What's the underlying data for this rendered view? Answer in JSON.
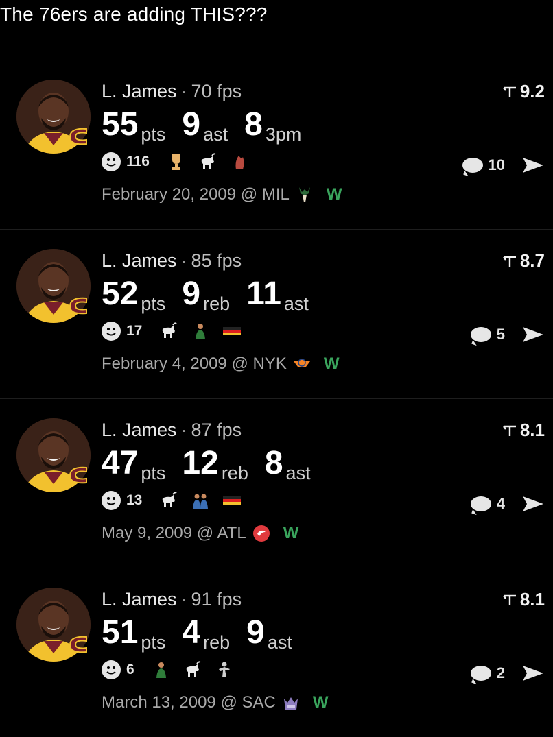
{
  "caption": "The 76ers are adding THIS???",
  "posts": [
    {
      "name": "L. James",
      "fps": "70 fps",
      "stats": [
        {
          "num": "55",
          "unit": "pts"
        },
        {
          "num": "9",
          "unit": "ast"
        },
        {
          "num": "8",
          "unit": "3pm"
        }
      ],
      "react_count": "116",
      "emojis": [
        "trophy-icon",
        "goat-icon",
        "fire-fist-icon"
      ],
      "date_line": "February 20, 2009 @ MIL",
      "opponent_logo": "bucks-logo-icon",
      "result": "W",
      "rating": "9.2",
      "comments": "10"
    },
    {
      "name": "L. James",
      "fps": "85 fps",
      "stats": [
        {
          "num": "52",
          "unit": "pts"
        },
        {
          "num": "9",
          "unit": "reb"
        },
        {
          "num": "11",
          "unit": "ast"
        }
      ],
      "react_count": "17",
      "emojis": [
        "goat-icon",
        "person-icon",
        "flag-icon"
      ],
      "date_line": "February 4, 2009 @ NYK",
      "opponent_logo": "knicks-logo-icon",
      "result": "W",
      "rating": "8.7",
      "comments": "5"
    },
    {
      "name": "L. James",
      "fps": "87 fps",
      "stats": [
        {
          "num": "47",
          "unit": "pts"
        },
        {
          "num": "12",
          "unit": "reb"
        },
        {
          "num": "8",
          "unit": "ast"
        }
      ],
      "react_count": "13",
      "emojis": [
        "goat-icon",
        "people-icon",
        "flag-icon"
      ],
      "date_line": "May 9, 2009 @ ATL",
      "opponent_logo": "hawks-logo-icon",
      "result": "W",
      "rating": "8.1",
      "comments": "4"
    },
    {
      "name": "L. James",
      "fps": "91 fps",
      "stats": [
        {
          "num": "51",
          "unit": "pts"
        },
        {
          "num": "4",
          "unit": "reb"
        },
        {
          "num": "9",
          "unit": "ast"
        }
      ],
      "react_count": "6",
      "emojis": [
        "person-icon",
        "goat-icon",
        "dunk-icon"
      ],
      "date_line": "March 13, 2009 @ SAC",
      "opponent_logo": "kings-logo-icon",
      "result": "W",
      "rating": "8.1",
      "comments": "2"
    }
  ],
  "colors": {
    "background": "#000000",
    "win": "#3aa55d",
    "jersey_gold": "#f2c12e",
    "cavs_wine": "#7a1f2b"
  }
}
